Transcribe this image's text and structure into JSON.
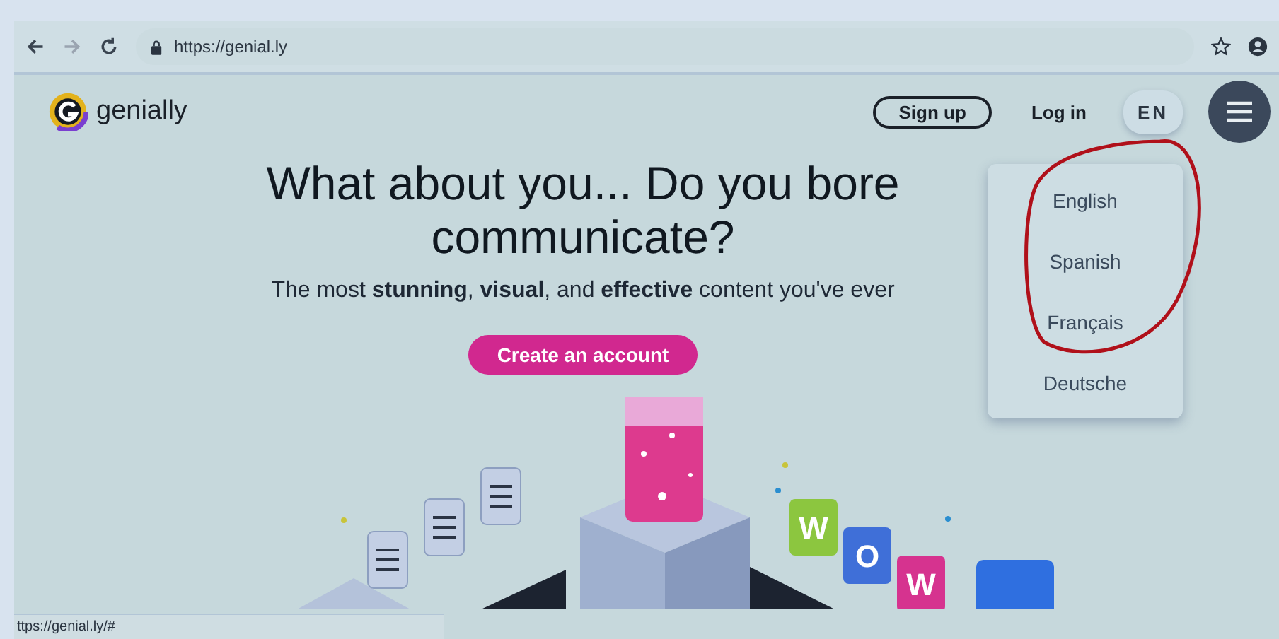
{
  "browser": {
    "url": "https://genial.ly",
    "status_url": "ttps://genial.ly/#"
  },
  "nav": {
    "brand": "genially",
    "sign_up": "Sign up",
    "log_in": "Log in",
    "language": "EN"
  },
  "language_menu": {
    "items": [
      {
        "label": "English"
      },
      {
        "label": "Spanish"
      },
      {
        "label": "Français"
      },
      {
        "label": "Deutsche"
      }
    ]
  },
  "hero": {
    "headline_line_1": "What about you... Do you bore",
    "headline_line_2": "communicate?",
    "subtitle": "The most **stunning**, **visual**, and **effective** content you've ever",
    "cta": "Create an account"
  },
  "illustration": {
    "tiles": [
      {
        "letter": "W",
        "color": "#8cc63f"
      },
      {
        "letter": "O",
        "color": "#3f6fd8"
      },
      {
        "letter": "W",
        "color": "#d6338f"
      }
    ]
  }
}
